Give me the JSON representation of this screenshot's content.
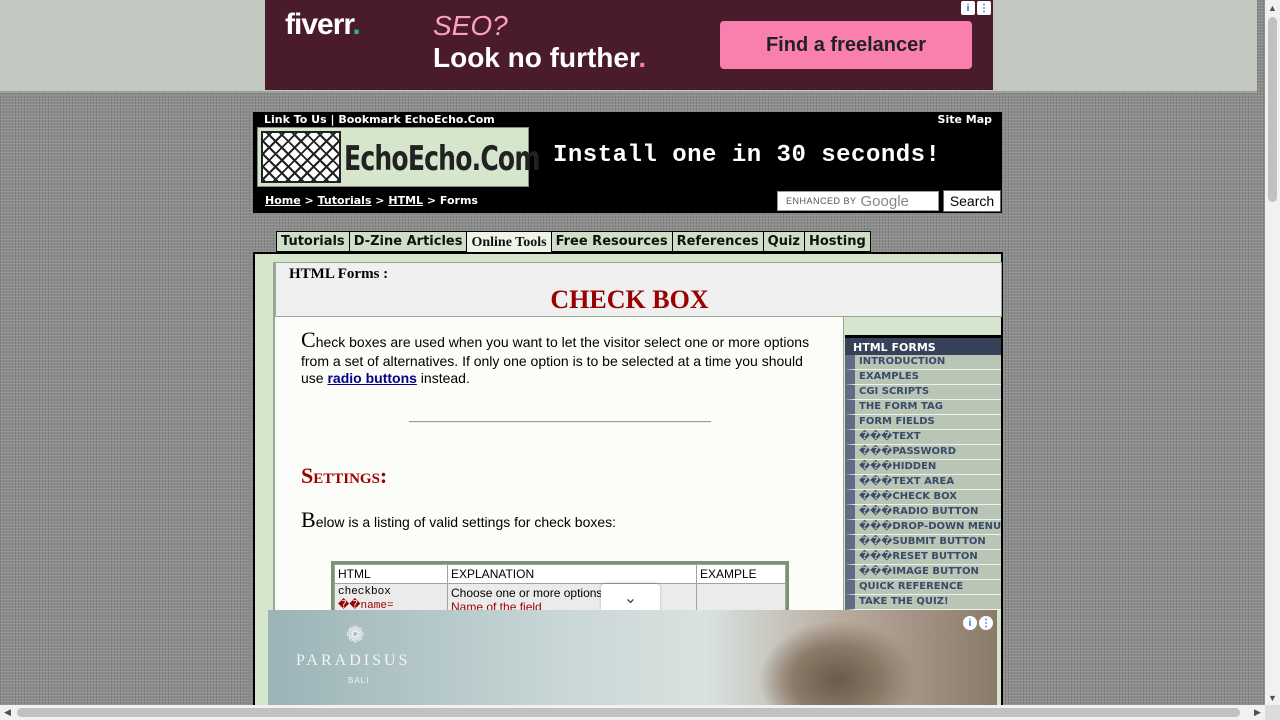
{
  "top_ad": {
    "brand": "fiverr",
    "line1": "SEO?",
    "line2": "Look no further",
    "cta": "Find a freelancer"
  },
  "header": {
    "top_links": "Link To Us | Bookmark EchoEcho.Com",
    "site_map": "Site Map",
    "logo_text": "EchoEcho.Com",
    "tagline": "Install one in 30 seconds!",
    "breadcrumb": [
      "Home",
      "Tutorials",
      "HTML",
      "Forms"
    ],
    "search_placeholder": "ENHANCED BY",
    "search_brand": "Google",
    "search_button": "Search"
  },
  "tabs": [
    "Tutorials",
    "D-Zine Articles",
    "Online Tools",
    "Free Resources",
    "References",
    "Quiz",
    "Hosting"
  ],
  "page": {
    "section": "HTML Forms :",
    "title": "CHECK BOX",
    "intro_drop": "C",
    "intro_text": "heck boxes are used when you want to let the visitor select one or more options from a set of alternatives. If only one option is to be selected at a time you should use",
    "intro_link": "radio buttons",
    "intro_end": "instead.",
    "settings_heading": "Settings:",
    "listing_drop": "B",
    "listing_text": "elow is a listing of valid settings for check boxes:"
  },
  "table": {
    "headers": [
      "HTML",
      "EXPLANATION",
      "EXAMPLE"
    ],
    "row": {
      "html_1": "checkbox",
      "html_2": "��name=",
      "expl_1": "Choose one or more options",
      "expl_2": "Name of the field"
    }
  },
  "sidenav": {
    "heading": "HTML FORMS",
    "items": [
      "INTRODUCTION",
      "EXAMPLES",
      "CGI SCRIPTS",
      "THE FORM TAG",
      "FORM FIELDS",
      "���TEXT",
      "���PASSWORD",
      "���HIDDEN",
      "���TEXT AREA",
      "���CHECK BOX",
      "���RADIO BUTTON",
      "���DROP-DOWN MENU",
      "���SUBMIT BUTTON",
      "���RESET BUTTON",
      "���IMAGE BUTTON",
      "QUICK REFERENCE",
      "TAKE THE QUIZ!"
    ]
  },
  "bottom_ad": {
    "brand": "PARADISUS",
    "sub1": "BALI"
  }
}
